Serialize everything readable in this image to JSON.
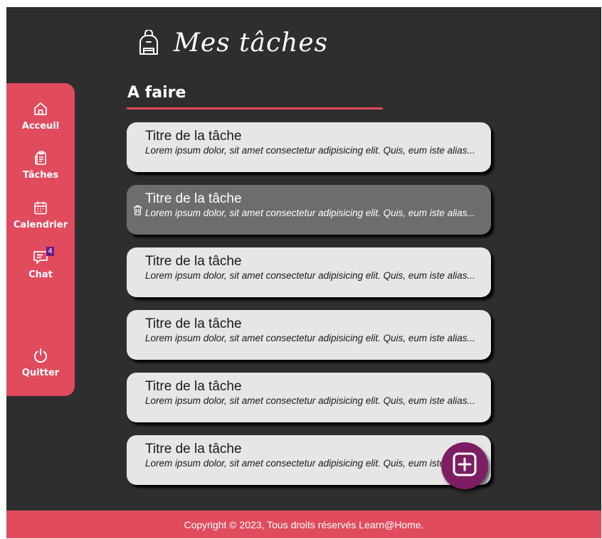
{
  "header": {
    "title": "Mes tâches",
    "logo_icon": "backpack-icon"
  },
  "sidebar": {
    "color": "#e04b5e",
    "items": [
      {
        "label": "Acceuil",
        "icon": "home-icon"
      },
      {
        "label": "Tâches",
        "icon": "clipboard-icon"
      },
      {
        "label": "Calendrier",
        "icon": "calendar-icon"
      },
      {
        "label": "Chat",
        "icon": "chat-icon",
        "badge": "4"
      },
      {
        "label": "Quitter",
        "icon": "power-icon"
      }
    ]
  },
  "section": {
    "title": "A faire"
  },
  "tasks": [
    {
      "title": "Titre de la tâche",
      "description": "Lorem ipsum dolor, sit amet consectetur adipisicing elit. Quis, eum iste alias..."
    },
    {
      "title": "Titre de la tâche",
      "description": "Lorem ipsum dolor, sit amet consectetur adipisicing elit. Quis, eum iste alias...",
      "state": "hovered",
      "action_icon": "trash-icon"
    },
    {
      "title": "Titre de la tâche",
      "description": "Lorem ipsum dolor, sit amet consectetur adipisicing elit. Quis, eum iste alias..."
    },
    {
      "title": "Titre de la tâche",
      "description": "Lorem ipsum dolor, sit amet consectetur adipisicing elit. Quis, eum iste alias..."
    },
    {
      "title": "Titre de la tâche",
      "description": "Lorem ipsum dolor, sit amet consectetur adipisicing elit. Quis, eum iste alias..."
    },
    {
      "title": "Titre de la tâche",
      "description": "Lorem ipsum dolor, sit amet consectetur adipisicing elit. Quis, eum iste alias..."
    }
  ],
  "fab": {
    "icon": "plus-square-icon",
    "color": "#7d1d63"
  },
  "footer": {
    "text": "Copyright © 2023, Tous droits réservés Learn@Home."
  },
  "colors": {
    "background": "#2e2e2e",
    "accent": "#e04b5e",
    "card": "#e6e6e6",
    "card_hover": "#6d6d6d",
    "badge": "#6b1a87"
  }
}
